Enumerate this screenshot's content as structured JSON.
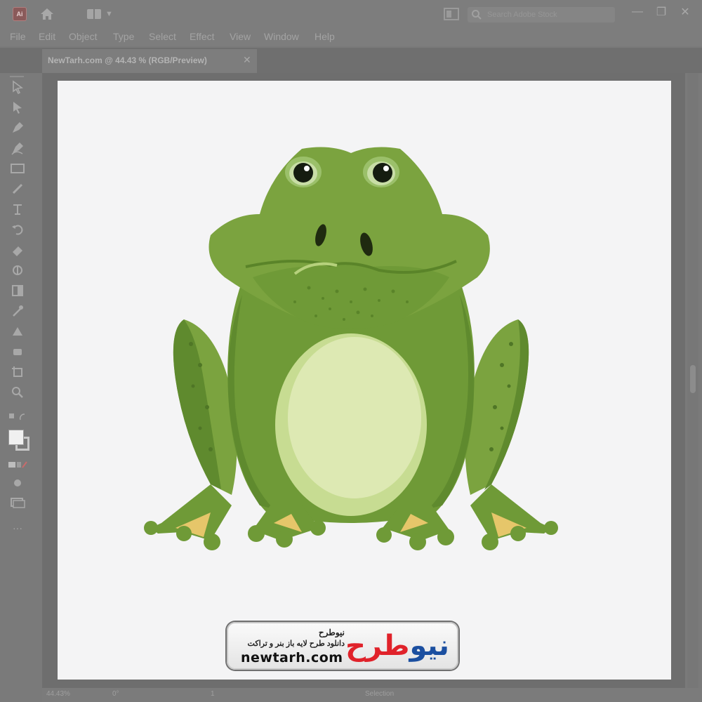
{
  "app": {
    "logo_text": "Ai"
  },
  "search": {
    "placeholder": "Search Adobe Stock"
  },
  "menu": {
    "items": [
      "File",
      "Edit",
      "Object",
      "Type",
      "Select",
      "Effect",
      "View",
      "Window",
      "Help"
    ]
  },
  "document_tab": {
    "label": "NewTarh.com @ 44.43 % (RGB/Preview)",
    "close_label": "✕"
  },
  "window_controls": {
    "minimize": "—",
    "restore": "❐",
    "close": "✕"
  },
  "toolbar": {
    "tools": [
      "selection-tool-icon",
      "direct-selection-tool-icon",
      "pen-tool-icon",
      "curvature-tool-icon",
      "rectangle-tool-icon",
      "paintbrush-tool-icon",
      "type-tool-icon",
      "rotate-tool-icon",
      "eraser-tool-icon",
      "shape-builder-tool-icon",
      "gradient-tool-icon",
      "eyedropper-tool-icon",
      "blend-tool-icon",
      "symbol-sprayer-tool-icon",
      "artboard-tool-icon",
      "zoom-tool-icon"
    ],
    "more_label": "···"
  },
  "status": {
    "zoom": "44.43%",
    "rotation": "0°",
    "artboard": "1",
    "mode": "Selection"
  },
  "watermark": {
    "name": "نیوطرح",
    "tagline": "دانلود طرح لایه باز بنر و تراکت",
    "url": "newtarh.com",
    "wordmark_a": "نیو",
    "wordmark_b": "طرح"
  },
  "colors": {
    "frog_body": "#7ba33f",
    "frog_dark": "#5f8a2e",
    "frog_belly": "#dde9b3",
    "toes": "#e6c66a",
    "artboard": "#f4f4f5"
  }
}
